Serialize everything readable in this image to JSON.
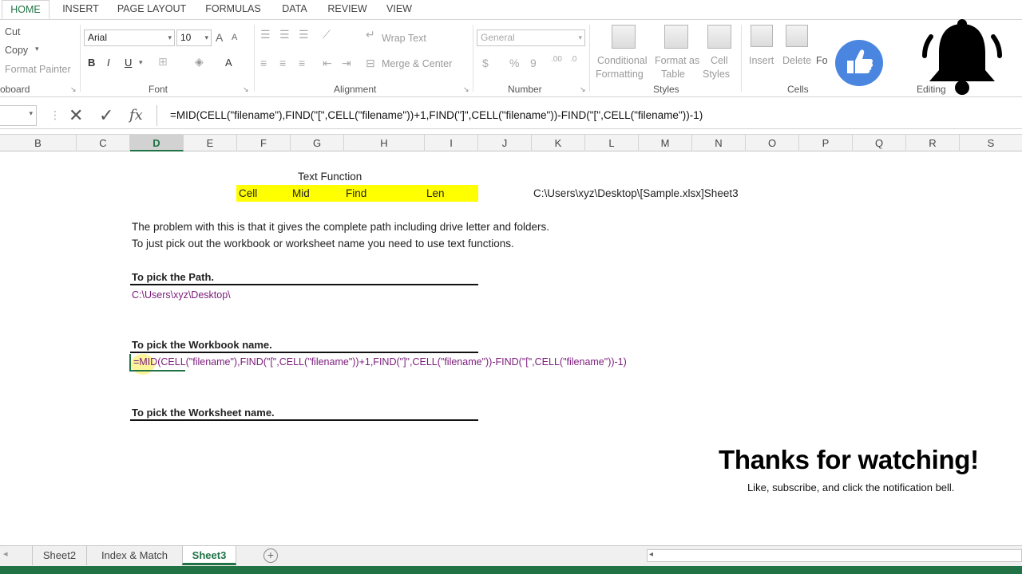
{
  "ribbon_tabs": [
    "HOME",
    "INSERT",
    "PAGE LAYOUT",
    "FORMULAS",
    "DATA",
    "REVIEW",
    "VIEW"
  ],
  "clipboard": {
    "cut": "Cut",
    "copy": "Copy",
    "format_painter": "Format Painter",
    "group": "oboard"
  },
  "font": {
    "name": "Arial",
    "size": "10",
    "group": "Font",
    "bold": "B",
    "italic": "I",
    "underline": "U",
    "grow": "A",
    "shrink": "A",
    "color": "A"
  },
  "alignment": {
    "wrap_text": "Wrap Text",
    "merge_center": "Merge & Center",
    "group": "Alignment"
  },
  "number": {
    "format": "General",
    "currency": "$",
    "percent": "%",
    "comma": "9",
    "group": "Number"
  },
  "styles": {
    "conditional_formatting_1": "Conditional",
    "conditional_formatting_2": "Formatting",
    "format_table_1": "Format as",
    "format_table_2": "Table",
    "cell_styles_1": "Cell",
    "cell_styles_2": "Styles",
    "group": "Styles"
  },
  "cells": {
    "insert": "Insert",
    "delete": "Delete",
    "format": "Fo",
    "group": "Cells"
  },
  "editing": {
    "group": "Editing"
  },
  "formula_bar": {
    "fx": "fx",
    "formula": "=MID(CELL(\"filename\"),FIND(\"[\",CELL(\"filename\"))+1,FIND(\"]\",CELL(\"filename\"))-FIND(\"[\",CELL(\"filename\"))-1)"
  },
  "columns": [
    "B",
    "C",
    "D",
    "E",
    "F",
    "G",
    "H",
    "I",
    "J",
    "K",
    "L",
    "M",
    "N",
    "O",
    "P",
    "Q",
    "R",
    "S"
  ],
  "selected_column": "D",
  "sheet": {
    "title": "Text Function",
    "functions": [
      "Cell",
      "Mid",
      "Find",
      "Len"
    ],
    "full_path": "C:\\Users\\xyz\\Desktop\\[Sample.xlsx]Sheet3",
    "problem_line1": "The problem with this is that it gives the complete path including drive letter and folders.",
    "problem_line2": "To just pick out the workbook or worksheet name you need to use text functions.",
    "path_heading": "To pick the Path.",
    "path_value": "C:\\Users\\xyz\\Desktop\\",
    "workbook_heading": "To pick the Workbook name.",
    "workbook_formula": "=MID(CELL(\"filename\"),FIND(\"[\",CELL(\"filename\"))+1,FIND(\"]\",CELL(\"filename\"))-FIND(\"[\",CELL(\"filename\"))-1)",
    "worksheet_heading": "To pick the Worksheet name."
  },
  "overlay": {
    "thanks": "Thanks for watching!",
    "subtitle": "Like, subscribe, and click the notification bell."
  },
  "sheet_tabs": [
    "Sheet2",
    "Index & Match",
    "Sheet3"
  ],
  "active_sheet": "Sheet3",
  "colors": {
    "excel_green": "#217346",
    "highlight_yellow": "#ffff00",
    "formula_purple": "#7a1a7a",
    "like_blue": "#4a86e0"
  }
}
